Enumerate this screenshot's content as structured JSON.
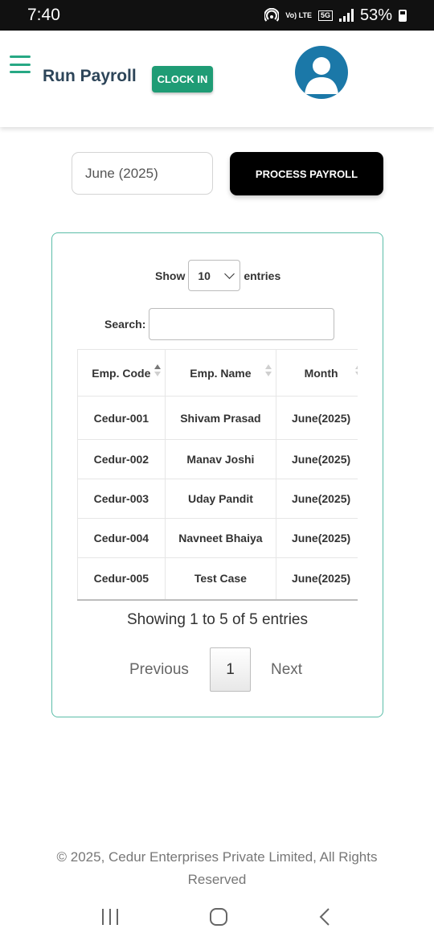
{
  "status_bar": {
    "time": "7:40",
    "network_volte": "Vo) LTE",
    "network_5g": "5G",
    "battery": "53%"
  },
  "header": {
    "title": "Run Payroll",
    "clock_in_label": "CLOCK IN"
  },
  "controls": {
    "month_value": "June (2025)",
    "process_label": "PROCESS PAYROLL"
  },
  "table_controls": {
    "show_label": "Show",
    "entries_value": "10",
    "entries_label": "entries",
    "search_label": "Search:",
    "search_value": ""
  },
  "table": {
    "columns": [
      "Emp. Code",
      "Emp. Name",
      "Month"
    ],
    "rows": [
      [
        "Cedur-001",
        "Shivam Prasad",
        "June(2025)"
      ],
      [
        "Cedur-002",
        "Manav Joshi",
        "June(2025)"
      ],
      [
        "Cedur-003",
        "Uday Pandit",
        "June(2025)"
      ],
      [
        "Cedur-004",
        "Navneet Bhaiya",
        "June(2025)"
      ],
      [
        "Cedur-005",
        "Test Case",
        "June(2025)"
      ]
    ]
  },
  "pagination": {
    "info": "Showing 1 to 5 of 5 entries",
    "previous": "Previous",
    "current": "1",
    "next": "Next"
  },
  "footer": {
    "text": "© 2025, Cedur Enterprises Private Limited, All Rights Reserved"
  },
  "icons": {
    "menu": "hamburger-icon",
    "avatar": "user-avatar-icon",
    "nav_recents": "recents-icon",
    "nav_home": "home-icon",
    "nav_back": "back-icon"
  },
  "colors": {
    "accent": "#27a884",
    "clock_in_bg": "#1f9c75",
    "title": "#2d4559",
    "avatar_bg": "#1b78a8",
    "card_border": "#5bbda8"
  }
}
